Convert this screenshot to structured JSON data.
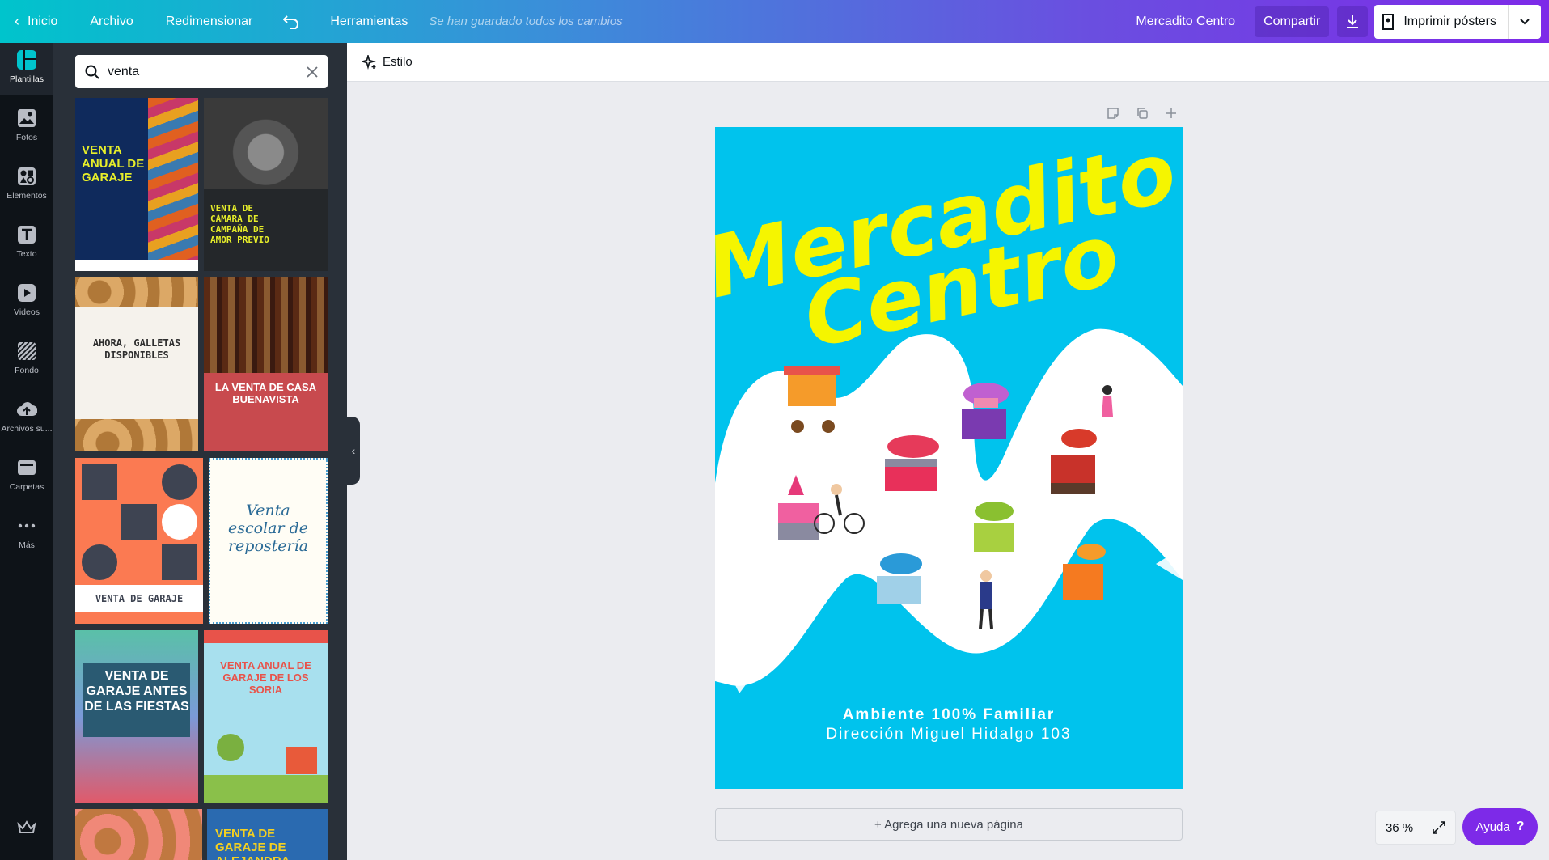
{
  "topbar": {
    "home": "Inicio",
    "file": "Archivo",
    "resize": "Redimensionar",
    "tools": "Herramientas",
    "saved_status": "Se han guardado todos los cambios",
    "project_name": "Mercadito Centro",
    "share": "Compartir",
    "print": "Imprimir pósters"
  },
  "rail": {
    "items": [
      {
        "label": "Plantillas",
        "icon": "templates-icon"
      },
      {
        "label": "Fotos",
        "icon": "photos-icon"
      },
      {
        "label": "Elementos",
        "icon": "elements-icon"
      },
      {
        "label": "Texto",
        "icon": "text-icon"
      },
      {
        "label": "Videos",
        "icon": "video-icon"
      },
      {
        "label": "Fondo",
        "icon": "background-icon"
      },
      {
        "label": "Archivos su...",
        "icon": "uploads-icon"
      },
      {
        "label": "Carpetas",
        "icon": "folders-icon"
      },
      {
        "label": "Más",
        "icon": "more-icon"
      }
    ]
  },
  "search": {
    "value": "venta"
  },
  "templates": [
    {
      "title": "VENTA ANUAL DE GARAJE"
    },
    {
      "title": "VENTA DE CÁMARA DE CAMPAÑA DE AMOR PREVIO"
    },
    {
      "title": "AHORA, GALLETAS DISPONIBLES"
    },
    {
      "title": "LA VENTA DE CASA BUENAVISTA"
    },
    {
      "title": "VENTA DE GARAJE"
    },
    {
      "title": "Venta escolar de repostería"
    },
    {
      "title": "VENTA DE GARAJE ANTES DE LAS FIESTAS"
    },
    {
      "title": "VENTA ANUAL DE GARAJE DE LOS SORIA"
    },
    {
      "title": ""
    },
    {
      "title": "VENTA DE GARAJE DE ALEJANDRA"
    }
  ],
  "editor": {
    "style_button": "Estilo",
    "add_page": "+ Agrega una nueva página",
    "zoom": "36 %",
    "help": "Ayuda"
  },
  "poster": {
    "title_line1": "Mercadito",
    "title_line2": "Centro",
    "subtitle1": "Ambiente 100% Familiar",
    "subtitle2": "Dirección Miguel Hidalgo 103"
  },
  "colors": {
    "poster_bg": "#00c3ed",
    "title_yellow": "#f5f500",
    "accent_purple": "#7d2ae8"
  }
}
